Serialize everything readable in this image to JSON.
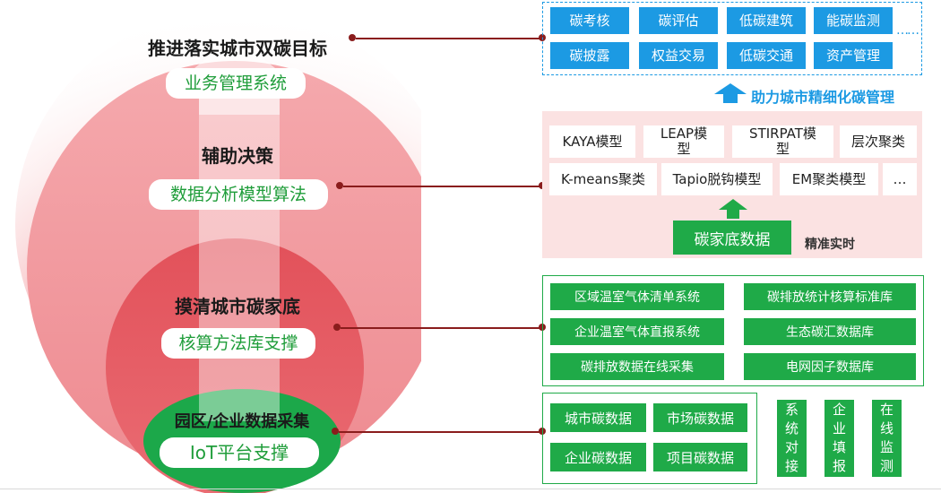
{
  "levels": [
    {
      "title": "推进落实城市双碳目标",
      "pill": "业务管理系统"
    },
    {
      "title": "辅助决策",
      "pill": "数据分析模型算法"
    },
    {
      "title": "摸清城市碳家底",
      "pill": "核算方法库支撑"
    },
    {
      "title": "园区/企业数据采集",
      "pill": "IoT平台支撑"
    }
  ],
  "business": {
    "items": [
      "碳考核",
      "碳评估",
      "低碳建筑",
      "能碳监测",
      "碳披露",
      "权益交易",
      "低碳交通",
      "资产管理"
    ],
    "more": "……",
    "arrow_label": "助力城市精细化碳管理"
  },
  "models": {
    "items": [
      "KAYA模型",
      "LEAP模型",
      "STIRPAT模型",
      "层次聚类",
      "K-means聚类",
      "Tapio脱钩模型",
      "EM聚类模型"
    ],
    "more": "…",
    "base_label": "碳家底数据",
    "realtime_label": "精准实时"
  },
  "accounting": {
    "items": [
      "区域温室气体清单系统",
      "碳排放统计核算标准库",
      "企业温室气体直报系统",
      "生态碳汇数据库",
      "碳排放数据在线采集",
      "电网因子数据库"
    ]
  },
  "collection": {
    "items": [
      "城市碳数据",
      "市场碳数据",
      "企业碳数据",
      "项目碳数据"
    ],
    "vertical": [
      "系统对接",
      "企业填报",
      "在线监测"
    ]
  },
  "colors": {
    "blue": "#1c9ae3",
    "green": "#1faa48",
    "pink_bg": "#fbe4e4",
    "red_mid": "#e8848a",
    "red_inner": "#e14b55",
    "connector": "#8a1c1c"
  }
}
